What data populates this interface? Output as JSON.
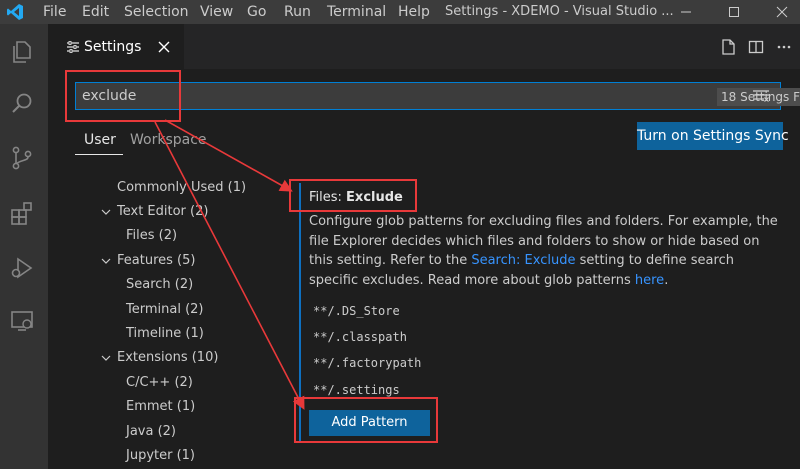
{
  "titlebar": {
    "menu": [
      "File",
      "Edit",
      "Selection",
      "View",
      "Go",
      "Run",
      "Terminal",
      "Help"
    ],
    "window_title": "Settings - XDEMO - Visual Studio ...",
    "icons": [
      "vscode-logo",
      "minimize-icon",
      "maximize-icon",
      "close-icon"
    ]
  },
  "activity_bar": {
    "icons": [
      "explorer-icon",
      "search-icon",
      "source-control-icon",
      "extensions-icon",
      "run-debug-icon",
      "remote-explorer-icon"
    ]
  },
  "editor": {
    "tab": {
      "label": "Settings",
      "icon": "settings-tab-icon"
    },
    "actions": [
      "open-settings-json-icon",
      "split-editor-icon",
      "more-actions-icon"
    ]
  },
  "search": {
    "value": "exclude",
    "count": "18 Settings Found",
    "filter_icon": "clear-filter-icon"
  },
  "scopes": {
    "user": "User",
    "workspace": "Workspace",
    "sync_button": "Turn on Settings Sync"
  },
  "toc": {
    "items": [
      {
        "label": "Commonly Used (1)",
        "expandable": false
      },
      {
        "label": "Text Editor (2)",
        "expandable": true
      },
      {
        "label": "Files (2)",
        "expandable": false
      },
      {
        "label": "Features (5)",
        "expandable": true
      },
      {
        "label": "Search (2)",
        "expandable": false
      },
      {
        "label": "Terminal (2)",
        "expandable": false
      },
      {
        "label": "Timeline (1)",
        "expandable": false
      },
      {
        "label": "Extensions (10)",
        "expandable": true
      },
      {
        "label": "C/C++ (2)",
        "expandable": false
      },
      {
        "label": "Emmet (1)",
        "expandable": false
      },
      {
        "label": "Java (2)",
        "expandable": false
      },
      {
        "label": "Jupyter (1)",
        "expandable": false
      }
    ]
  },
  "setting": {
    "category": "Files: ",
    "name": "Exclude",
    "desc_1": "Configure glob patterns for excluding files and folders. For example, the file Explorer decides which files and folders to show or hide based on this setting. Refer to the ",
    "desc_link": "Search: Exclude",
    "desc_2": " setting to define search specific excludes. Read more about glob patterns ",
    "desc_here": "here",
    "desc_end": ".",
    "patterns": [
      "**/.DS_Store",
      "**/.classpath",
      "**/.factorypath",
      "**/.settings"
    ],
    "add_button": "Add Pattern"
  },
  "colors": {
    "accent": "#0e639c",
    "focus_border": "#007fd4",
    "link": "#3794ff",
    "annotation": "#e8393a"
  }
}
